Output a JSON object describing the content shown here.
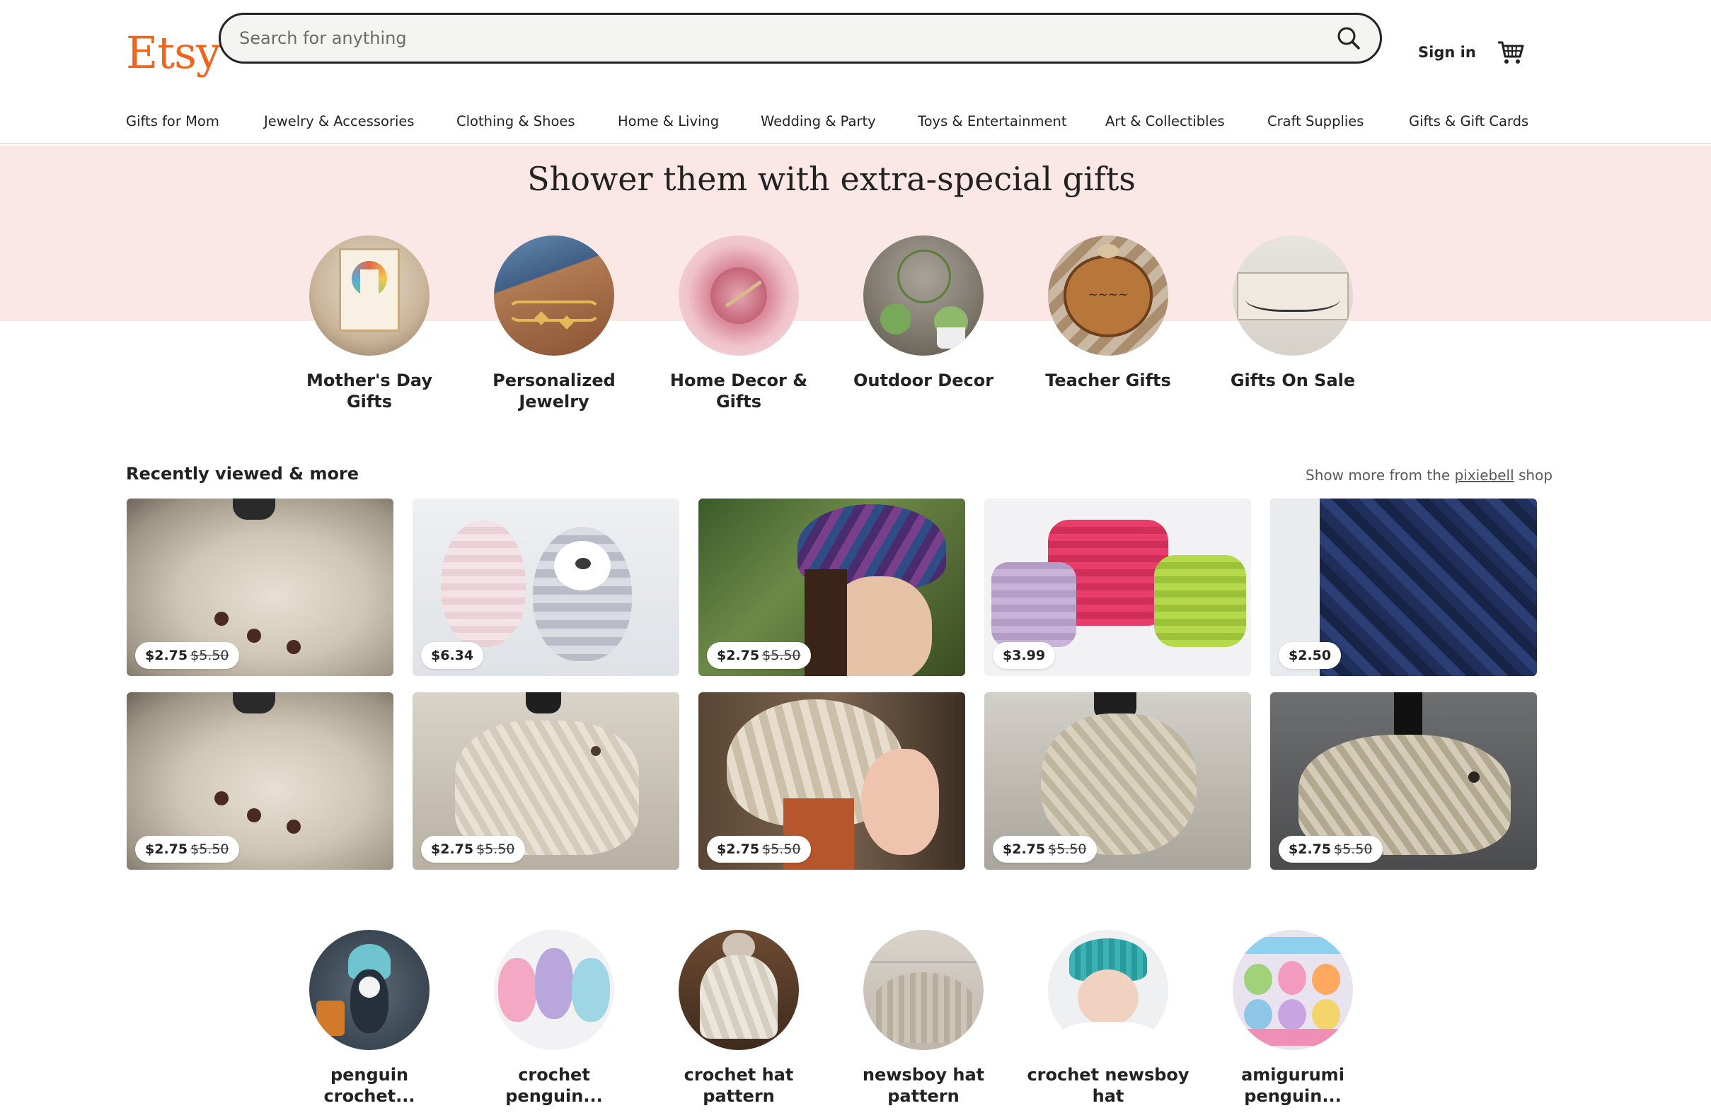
{
  "header": {
    "logo": "Etsy",
    "search_placeholder": "Search for anything",
    "sign_in": "Sign in"
  },
  "nav": [
    "Gifts for Mom",
    "Jewelry & Accessories",
    "Clothing & Shoes",
    "Home & Living",
    "Wedding & Party",
    "Toys & Entertainment",
    "Art & Collectibles",
    "Craft Supplies",
    "Gifts & Gift Cards"
  ],
  "hero": {
    "title": "Shower them with extra-special gifts",
    "categories": [
      {
        "label": "Mother's Day Gifts"
      },
      {
        "label": "Personalized Jewelry"
      },
      {
        "label": "Home Decor & Gifts"
      },
      {
        "label": "Outdoor Decor"
      },
      {
        "label": "Teacher Gifts"
      },
      {
        "label": "Gifts On Sale"
      }
    ]
  },
  "recent": {
    "title": "Recently viewed & more",
    "more_prefix": "Show more from the",
    "more_shop": "pixiebell",
    "more_suffix": "shop",
    "items": [
      {
        "price": "$2.75",
        "original": "$5.50"
      },
      {
        "price": "$6.34",
        "original": ""
      },
      {
        "price": "$2.75",
        "original": "$5.50"
      },
      {
        "price": "$3.99",
        "original": ""
      },
      {
        "price": "$2.50",
        "original": ""
      },
      {
        "price": "$2.75",
        "original": "$5.50"
      },
      {
        "price": "$2.75",
        "original": "$5.50"
      },
      {
        "price": "$2.75",
        "original": "$5.50"
      },
      {
        "price": "$2.75",
        "original": "$5.50"
      },
      {
        "price": "$2.75",
        "original": "$5.50"
      }
    ]
  },
  "related_searches": [
    {
      "label": "penguin crochet..."
    },
    {
      "label": "crochet penguin..."
    },
    {
      "label": "crochet hat pattern"
    },
    {
      "label": "newsboy hat pattern"
    },
    {
      "label": "crochet newsboy hat"
    },
    {
      "label": "amigurumi penguin..."
    }
  ],
  "colors": {
    "brand": "#f1641e",
    "hero_band": "#fbe8e6",
    "text": "#222222"
  }
}
